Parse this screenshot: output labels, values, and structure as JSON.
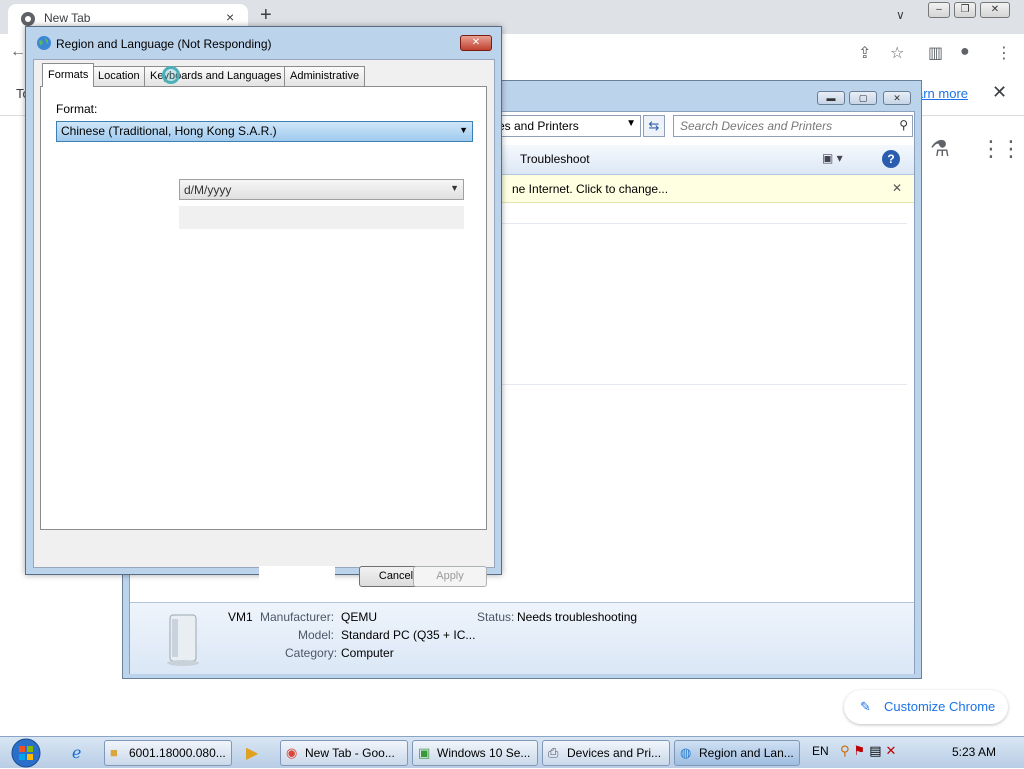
{
  "chrome": {
    "tab_title": "New Tab",
    "tab_close": "×",
    "new_tab": "+",
    "tab_search": "∨",
    "infobar_left": "To",
    "infobar_link": "arn more",
    "infobar_close": "✕",
    "customize_label": "Customize Chrome"
  },
  "devices_window": {
    "address_text": "es and Printers",
    "search_placeholder": "Search Devices and Printers",
    "troubleshoot_label": "Troubleshoot",
    "notice_text": "ne Internet. Click to change...",
    "notice_close": "✕",
    "device": {
      "name": "VM1",
      "manufacturer_label": "Manufacturer:",
      "manufacturer": "QEMU",
      "model_label": "Model:",
      "model": "Standard PC (Q35 + IC...",
      "category_label": "Category:",
      "category": "Computer",
      "status_label": "Status:",
      "status": "Needs troubleshooting"
    }
  },
  "region_dialog": {
    "title": "Region and Language (Not Responding)",
    "tabs": [
      {
        "label": "Formats"
      },
      {
        "label": "Location"
      },
      {
        "label": "Keyboards and Languages"
      },
      {
        "label": "Administrative"
      }
    ],
    "format_label": "Format:",
    "format_value": "Chinese (Traditional, Hong Kong S.A.R.)",
    "date_format_value": "d/M/yyyy",
    "cancel_label": "Cancel",
    "apply_label": "Apply",
    "close_glyph": "✕"
  },
  "taskbar": {
    "buttons": [
      {
        "label": "6001.18000.080...",
        "icon": "folder-icon"
      },
      {
        "label": "New Tab - Goo...",
        "icon": "chrome-icon"
      },
      {
        "label": "Windows 10 Se...",
        "icon": "window-icon"
      },
      {
        "label": "Devices and Pri...",
        "icon": "printer-icon"
      },
      {
        "label": "Region and Lan...",
        "icon": "globe-icon"
      }
    ],
    "language": "EN",
    "clock": "5:23 AM"
  },
  "colors": {
    "accent": "#1a73e8",
    "selection": "#9fcaee",
    "notice": "#ffffe1"
  }
}
